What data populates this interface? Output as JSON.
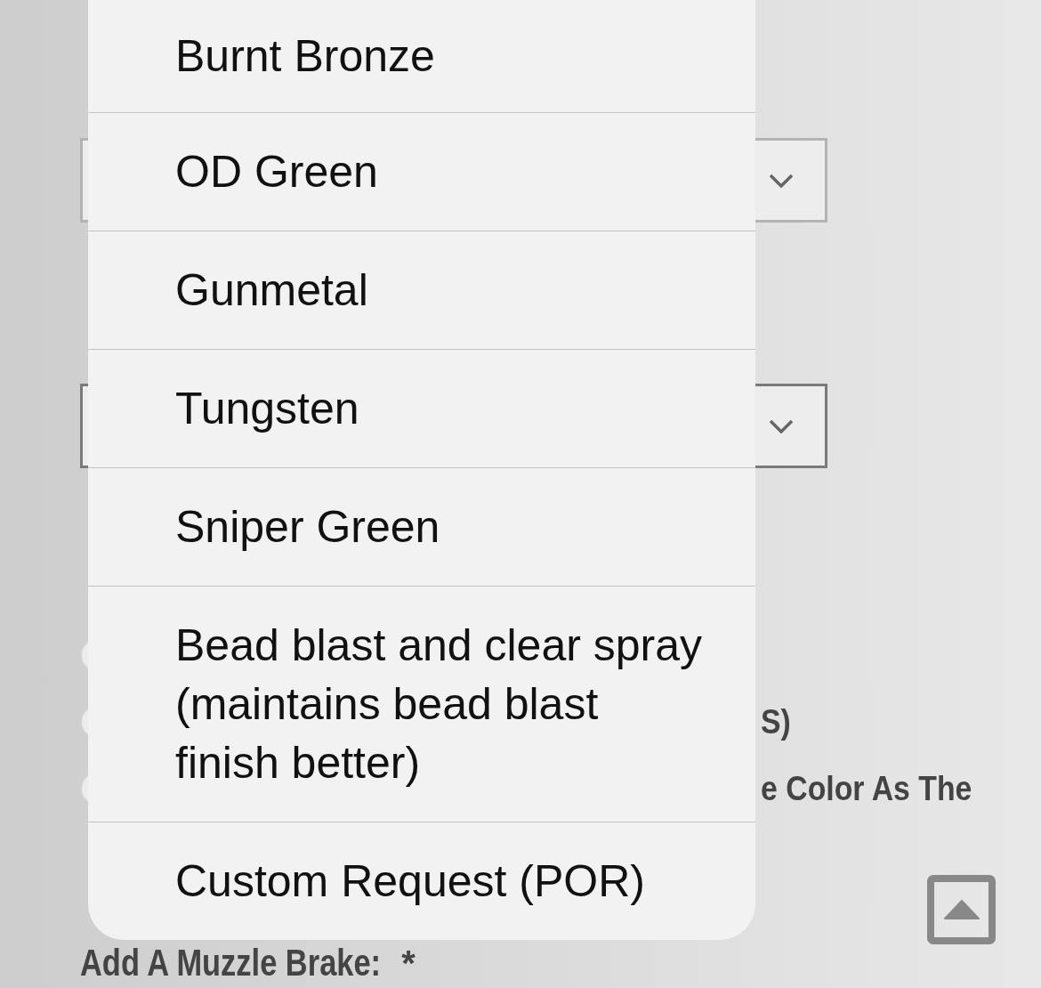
{
  "form": {
    "selects": [
      {
        "focused": false
      },
      {
        "focused": true
      }
    ],
    "radio_options": [
      {
        "checked": false
      },
      {
        "checked": false,
        "label": "S)"
      },
      {
        "checked": false,
        "label": "e Color As The"
      }
    ],
    "field_label": {
      "text": "Add A Muzzle Brake:",
      "required_mark": "*"
    }
  },
  "picker": {
    "options": [
      {
        "label": "Burnt Bronze",
        "selected": false
      },
      {
        "label": "OD Green",
        "selected": false
      },
      {
        "label": "Gunmetal",
        "selected": false
      },
      {
        "label": "Tungsten",
        "selected": false
      },
      {
        "label": "Sniper Green",
        "selected": false
      },
      {
        "label": "Bead blast and clear spray (maintains bead blast finish better)",
        "selected": false
      },
      {
        "label": "Custom Request (POR)",
        "selected": false
      }
    ]
  }
}
